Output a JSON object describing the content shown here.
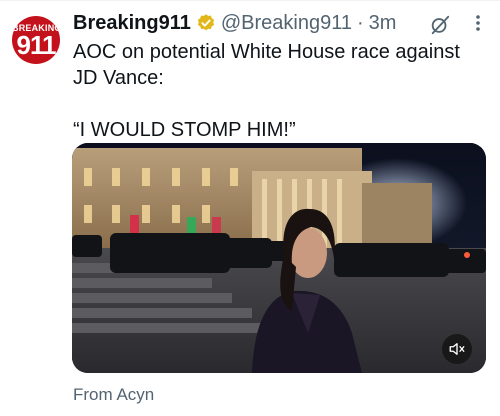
{
  "author": {
    "avatar_line1": "BREAKING",
    "avatar_line2": "911",
    "display_name": "Breaking911",
    "handle": "@Breaking911",
    "separator": "·",
    "time": "3m"
  },
  "tweet": {
    "text": "AOC on potential White House race against JD Vance:\n\n“I WOULD STOMP HIM!”",
    "source_label": "From Acyn"
  },
  "media": {
    "type": "video",
    "muted": true
  },
  "icons": {
    "verified": "verified-badge-icon",
    "grok": "grok-icon",
    "more": "more-options-icon",
    "mute": "volume-muted-icon"
  },
  "colors": {
    "text": "#0f1419",
    "secondary": "#536471",
    "verified_gold": "#e2b719",
    "avatar_red": "#c3121b"
  }
}
